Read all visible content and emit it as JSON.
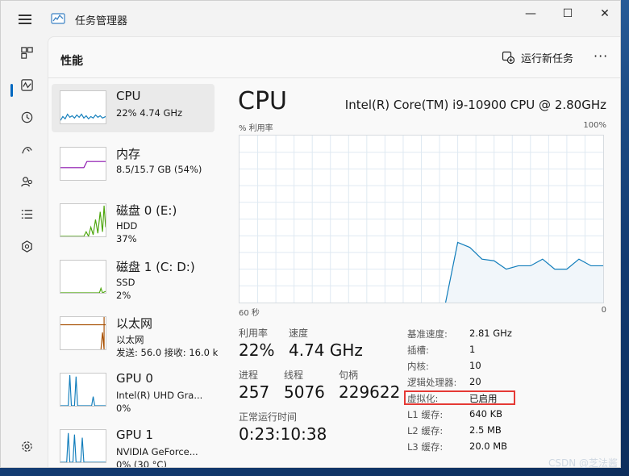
{
  "window": {
    "title": "任务管理器",
    "app_icon": "task-manager-icon"
  },
  "header": {
    "page_title": "性能",
    "run_task_label": "运行新任务",
    "more_label": "···"
  },
  "nav_items": [
    {
      "name": "processes-icon"
    },
    {
      "name": "performance-icon",
      "selected": true
    },
    {
      "name": "app-history-icon"
    },
    {
      "name": "startup-icon"
    },
    {
      "name": "users-icon"
    },
    {
      "name": "details-icon"
    },
    {
      "name": "services-icon"
    },
    {
      "name": "settings-icon"
    }
  ],
  "devices": [
    {
      "name": "CPU",
      "line2": "22%  4.74 GHz",
      "line3": "",
      "color": "#117dbb",
      "selected": true
    },
    {
      "name": "内存",
      "line2": "8.5/15.7 GB (54%)",
      "line3": "",
      "color": "#8b12ae"
    },
    {
      "name": "磁盘 0 (E:)",
      "line2": "HDD",
      "line3": "37%",
      "color": "#4da60c"
    },
    {
      "name": "磁盘 1 (C: D:)",
      "line2": "SSD",
      "line3": "2%",
      "color": "#4da60c"
    },
    {
      "name": "以太网",
      "line2": "以太网",
      "line3": "发送: 56.0  接收: 16.0 k",
      "color": "#a74f01"
    },
    {
      "name": "GPU 0",
      "line2": "Intel(R) UHD Gra...",
      "line3": "0%",
      "color": "#117dbb"
    },
    {
      "name": "GPU 1",
      "line2": "NVIDIA GeForce...",
      "line3": "0% (30 °C)",
      "color": "#117dbb"
    }
  ],
  "main": {
    "title": "CPU",
    "model": "Intel(R) Core(TM) i9-10900 CPU @ 2.80GHz",
    "graph_label": "% 利用率",
    "graph_max": "100%",
    "time_span": "60 秒",
    "graph_min": "0",
    "stats": {
      "utilization_label": "利用率",
      "utilization": "22%",
      "speed_label": "速度",
      "speed": "4.74 GHz",
      "processes_label": "进程",
      "processes": "257",
      "threads_label": "线程",
      "threads": "5076",
      "handles_label": "句柄",
      "handles": "229622",
      "uptime_label": "正常运行时间",
      "uptime": "0:23:10:38"
    },
    "specs": [
      {
        "k": "基准速度:",
        "v": "2.81 GHz"
      },
      {
        "k": "插槽:",
        "v": "1"
      },
      {
        "k": "内核:",
        "v": "10"
      },
      {
        "k": "逻辑处理器:",
        "v": "20"
      },
      {
        "k": "虚拟化:",
        "v": "已启用"
      },
      {
        "k": "L1 缓存:",
        "v": "640 KB"
      },
      {
        "k": "L2 缓存:",
        "v": "2.5 MB"
      },
      {
        "k": "L3 缓存:",
        "v": "20.0 MB"
      }
    ]
  },
  "chart_data": {
    "type": "area",
    "xlabel": "60 秒",
    "ylabel": "% 利用率",
    "ylim": [
      0,
      100
    ],
    "x": [
      60,
      58,
      56,
      54,
      52,
      50,
      48,
      46,
      44,
      42,
      40,
      38,
      36,
      34,
      32,
      30,
      28,
      26,
      24,
      22,
      20,
      18,
      16,
      14,
      12,
      10,
      8,
      6,
      4,
      2,
      0
    ],
    "values": [
      0,
      0,
      0,
      0,
      0,
      0,
      0,
      0,
      0,
      0,
      0,
      0,
      0,
      0,
      0,
      0,
      0,
      0,
      36,
      33,
      26,
      25,
      20,
      22,
      22,
      26,
      20,
      20,
      26,
      22,
      22
    ],
    "grid": true
  },
  "watermark": "CSDN @芝法酱",
  "colors": {
    "cpu_line": "#117dbb",
    "cpu_fill": "#f1f6fa",
    "highlight": "#e53935"
  }
}
